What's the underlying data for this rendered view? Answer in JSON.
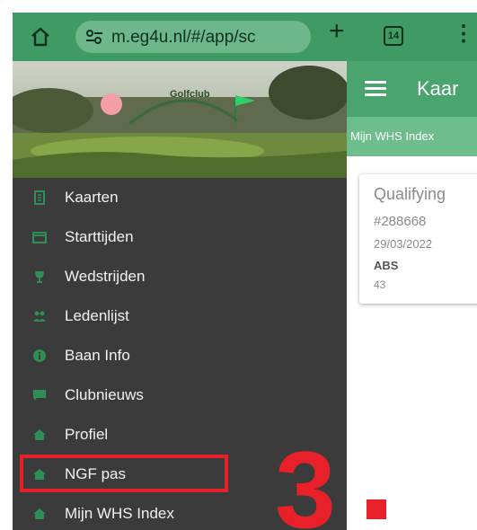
{
  "browser": {
    "url": "m.eg4u.nl/#/app/sc",
    "tab_count": "14",
    "home_icon": "home-icon",
    "site_settings_icon": "tune-icon",
    "new_tab_icon": "plus-icon",
    "overflow_icon": "more-vert-icon"
  },
  "sidebar": {
    "banner_text": "Golfclub",
    "items": [
      {
        "label": "Kaarten",
        "icon": "scorecard-icon"
      },
      {
        "label": "Starttijden",
        "icon": "calendar-icon"
      },
      {
        "label": "Wedstrijden",
        "icon": "trophy-icon"
      },
      {
        "label": "Ledenlijst",
        "icon": "people-icon"
      },
      {
        "label": "Baan Info",
        "icon": "info-icon"
      },
      {
        "label": "Clubnieuws",
        "icon": "chat-icon"
      },
      {
        "label": "Profiel",
        "icon": "house-icon"
      },
      {
        "label": "NGF pas",
        "icon": "house-icon"
      },
      {
        "label": "Mijn WHS Index",
        "icon": "house-icon"
      }
    ]
  },
  "main": {
    "title": "Kaar",
    "subbar": "Mijn WHS Index",
    "card": {
      "title": "Qualifying",
      "id": "#288668",
      "date": "29/03/2022",
      "type": "ABS",
      "score": "43"
    }
  },
  "annotation": {
    "step": "3",
    "color": "#e8202a"
  },
  "colors": {
    "browser_bar": "#3f9a63",
    "toolbar": "#4aa46e",
    "sidebar": "#3b3b3b",
    "accent_red": "#e8202a"
  }
}
